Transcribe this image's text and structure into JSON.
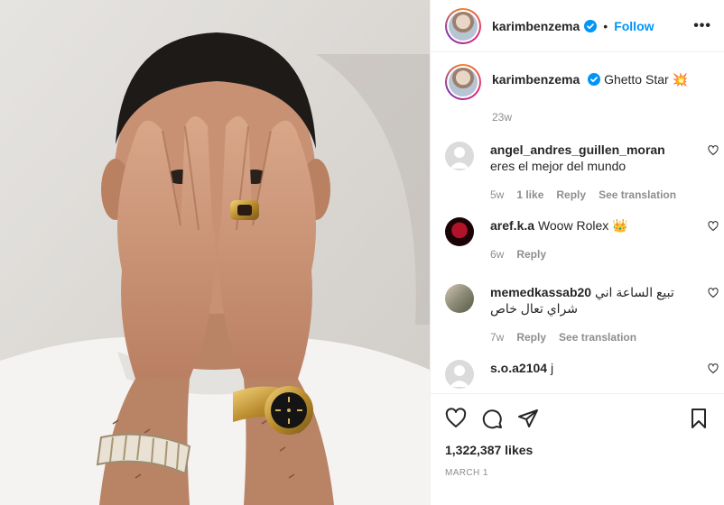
{
  "header": {
    "username": "karimbenzema",
    "separator": "•",
    "follow_label": "Follow",
    "more_label": "•••"
  },
  "caption": {
    "username": "karimbenzema",
    "text": "Ghetto Star",
    "emoji": "💥",
    "time": "23w"
  },
  "comments": [
    {
      "username": "angel_andres_guillen_moran",
      "text": "eres el mejor del mundo",
      "time": "5w",
      "likes": "1 like",
      "reply": "Reply",
      "translate": "See translation"
    },
    {
      "username": "aref.k.a",
      "text": "Woow Rolex",
      "emoji": "👑",
      "time": "6w",
      "reply": "Reply"
    },
    {
      "username": "memedkassab20",
      "text": "تبيع الساعة اني شراي تعال خاص",
      "time": "7w",
      "reply": "Reply",
      "translate": "See translation"
    },
    {
      "username": "s.o.a2104",
      "text": "j"
    }
  ],
  "footer": {
    "likes": "1,322,387 likes",
    "date": "MARCH 1"
  },
  "colors": {
    "accent": "#0095f6",
    "muted": "#8e8e8e",
    "text": "#262626"
  },
  "icons": {
    "verified": "verified-badge-icon",
    "like": "heart-icon",
    "comment": "comment-bubble-icon",
    "share": "paper-plane-icon",
    "save": "bookmark-icon"
  }
}
